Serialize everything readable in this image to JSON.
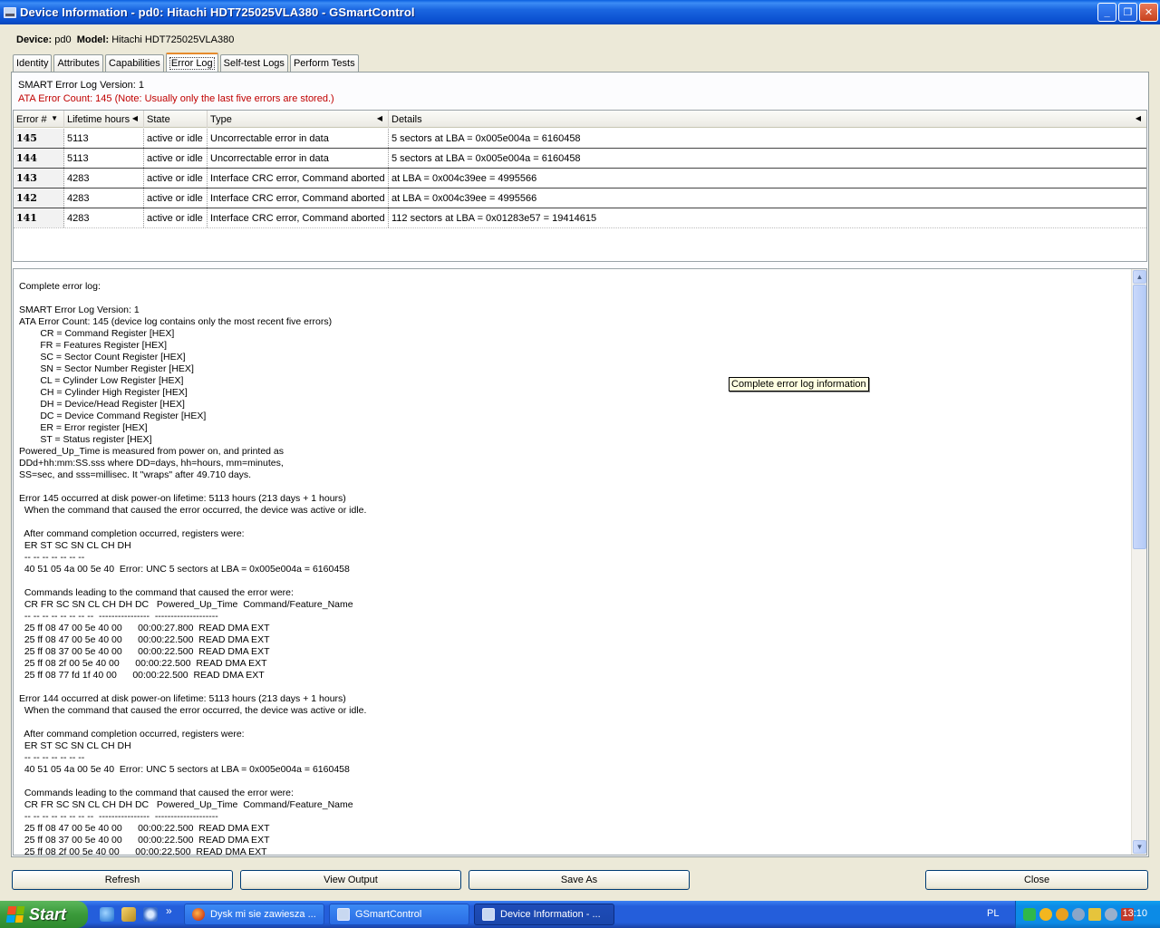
{
  "window": {
    "title": "Device Information - pd0: Hitachi HDT725025VLA380 - GSmartControl",
    "minimize": "_",
    "maximize": "❐",
    "close": "✕"
  },
  "device": {
    "device_label": "Device:",
    "device_value": "pd0",
    "model_label": "Model:",
    "model_value": "Hitachi HDT725025VLA380"
  },
  "tabs": [
    {
      "label": "Identity"
    },
    {
      "label": "Attributes"
    },
    {
      "label": "Capabilities"
    },
    {
      "label": "Error Log"
    },
    {
      "label": "Self-test Logs"
    },
    {
      "label": "Perform Tests"
    }
  ],
  "error_log": {
    "version_text": "SMART Error Log Version: 1",
    "count_text": "ATA Error Count: 145 (Note: Usually only the last five errors are stored.)",
    "columns": [
      "Error #",
      "Lifetime hours",
      "State",
      "Type",
      "Details"
    ],
    "rows": [
      {
        "num": "145",
        "hours": "5113",
        "state": "active or idle",
        "type": "Uncorrectable error in data",
        "details": "5 sectors at LBA = 0x005e004a = 6160458"
      },
      {
        "num": "144",
        "hours": "5113",
        "state": "active or idle",
        "type": "Uncorrectable error in data",
        "details": "5 sectors at LBA = 0x005e004a = 6160458"
      },
      {
        "num": "143",
        "hours": "4283",
        "state": "active or idle",
        "type": "Interface CRC error, Command aborted",
        "details": "at LBA = 0x004c39ee = 4995566"
      },
      {
        "num": "142",
        "hours": "4283",
        "state": "active or idle",
        "type": "Interface CRC error, Command aborted",
        "details": "at LBA = 0x004c39ee = 4995566"
      },
      {
        "num": "141",
        "hours": "4283",
        "state": "active or idle",
        "type": "Interface CRC error, Command aborted",
        "details": "112 sectors at LBA = 0x01283e57 = 19414615"
      }
    ]
  },
  "complete_log": "Complete error log:\n\nSMART Error Log Version: 1\nATA Error Count: 145 (device log contains only the most recent five errors)\n        CR = Command Register [HEX]\n        FR = Features Register [HEX]\n        SC = Sector Count Register [HEX]\n        SN = Sector Number Register [HEX]\n        CL = Cylinder Low Register [HEX]\n        CH = Cylinder High Register [HEX]\n        DH = Device/Head Register [HEX]\n        DC = Device Command Register [HEX]\n        ER = Error register [HEX]\n        ST = Status register [HEX]\nPowered_Up_Time is measured from power on, and printed as\nDDd+hh:mm:SS.sss where DD=days, hh=hours, mm=minutes,\nSS=sec, and sss=millisec. It \"wraps\" after 49.710 days.\n\nError 145 occurred at disk power-on lifetime: 5113 hours (213 days + 1 hours)\n  When the command that caused the error occurred, the device was active or idle.\n\n  After command completion occurred, registers were:\n  ER ST SC SN CL CH DH\n  -- -- -- -- -- -- --\n  40 51 05 4a 00 5e 40  Error: UNC 5 sectors at LBA = 0x005e004a = 6160458\n\n  Commands leading to the command that caused the error were:\n  CR FR SC SN CL CH DH DC   Powered_Up_Time  Command/Feature_Name\n  -- -- -- -- -- -- -- --  ----------------  --------------------\n  25 ff 08 47 00 5e 40 00      00:00:27.800  READ DMA EXT\n  25 ff 08 47 00 5e 40 00      00:00:22.500  READ DMA EXT\n  25 ff 08 37 00 5e 40 00      00:00:22.500  READ DMA EXT\n  25 ff 08 2f 00 5e 40 00      00:00:22.500  READ DMA EXT\n  25 ff 08 77 fd 1f 40 00      00:00:22.500  READ DMA EXT\n\nError 144 occurred at disk power-on lifetime: 5113 hours (213 days + 1 hours)\n  When the command that caused the error occurred, the device was active or idle.\n\n  After command completion occurred, registers were:\n  ER ST SC SN CL CH DH\n  -- -- -- -- -- -- --\n  40 51 05 4a 00 5e 40  Error: UNC 5 sectors at LBA = 0x005e004a = 6160458\n\n  Commands leading to the command that caused the error were:\n  CR FR SC SN CL CH DH DC   Powered_Up_Time  Command/Feature_Name\n  -- -- -- -- -- -- -- --  ----------------  --------------------\n  25 ff 08 47 00 5e 40 00      00:00:22.500  READ DMA EXT\n  25 ff 08 37 00 5e 40 00      00:00:22.500  READ DMA EXT\n  25 ff 08 2f 00 5e 40 00      00:00:22.500  READ DMA EXT",
  "tooltip": "Complete error log information",
  "buttons": {
    "refresh": "Refresh",
    "view_output": "View Output",
    "save_as": "Save As",
    "close": "Close"
  },
  "taskbar": {
    "start": "Start",
    "tasks": [
      {
        "label": "Dysk mi sie zawiesza ..."
      },
      {
        "label": "GSmartControl"
      },
      {
        "label": "Device Information - ..."
      }
    ],
    "language": "PL",
    "clock": "13:10",
    "more": "»"
  },
  "colors": {
    "title_bar": "#0a4fd0",
    "error_count_text": "#c00000",
    "active_tab_accent": "#e68b2c",
    "tooltip_bg": "#ffffe1",
    "taskbar": "#245edb",
    "start_button": "#3a9a3a"
  }
}
